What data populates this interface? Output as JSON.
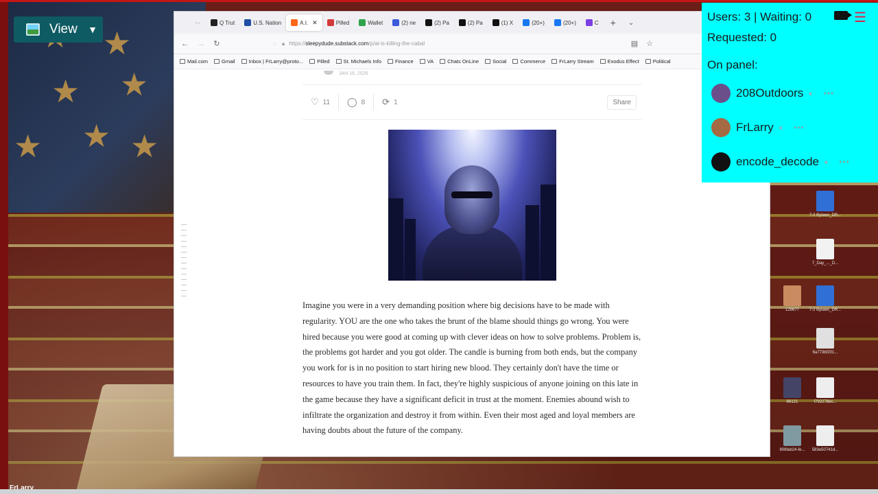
{
  "view_widget": {
    "label": "View"
  },
  "browser": {
    "tabs": [
      {
        "label": "Q Trut",
        "color": "#222222"
      },
      {
        "label": "U.S. Nation",
        "color": "#1f4ea3"
      },
      {
        "label": "A.I.",
        "color": "#ff6719",
        "active": true
      },
      {
        "label": "Pilled",
        "color": "#d33b3b"
      },
      {
        "label": "Wallet",
        "color": "#2fa34a"
      },
      {
        "label": "(2) ne",
        "color": "#3b5bdb"
      },
      {
        "label": "(2) Pa",
        "color": "#111111"
      },
      {
        "label": "(2) Pa",
        "color": "#111111"
      },
      {
        "label": "(1) X",
        "color": "#111111"
      },
      {
        "label": "(20+)",
        "color": "#1877f2"
      },
      {
        "label": "(20+)",
        "color": "#1877f2"
      },
      {
        "label": "C",
        "color": "#7b3fe4"
      }
    ],
    "url_prefix": "https://",
    "url_domain": "sleepydude.substack.com",
    "url_path": "/p/ai-is-killing-the-cabal",
    "bookmarks": [
      "Mail.com",
      "Gmail",
      "Inbox | FrLarry@proto...",
      "Pilled",
      "St. Michaels Info",
      "Finance",
      "VA",
      "Chats OnLine",
      "Social",
      "Commerce",
      "FrLarry Stream",
      "Exodus Effect",
      "Political"
    ]
  },
  "article": {
    "date": "JAN 16, 2026",
    "likes": "11",
    "comments": "8",
    "restacks": "1",
    "share_label": "Share",
    "body": "Imagine you were in a very demanding position where big decisions have to be made with regularity. YOU are the one who takes the brunt of the blame should things go wrong. You were hired because you were good at coming up with clever ideas on how to solve problems. Problem is, the problems got harder and you got older. The candle is burning from both ends, but the company you work for is in no position to start hiring new blood. They certainly don't have the time or resources to have you train them. In fact, they're highly suspicious of anyone joining on this late in the game because they have a significant deficit in trust at the moment. Enemies abound wish to infiltrate the organization and destroy it from within. Even their most aged and loyal members are having doubts about the future of the company."
  },
  "users_panel": {
    "users_line": "Users: 3 | Waiting: 0",
    "requested_line": "Requested: 0",
    "on_panel_label": "On panel:",
    "members": [
      {
        "name": "208Outdoors",
        "avatar_color": "#6b4f8a"
      },
      {
        "name": "FrLarry",
        "avatar_color": "#a46a44"
      },
      {
        "name": "encode_decode",
        "avatar_color": "#111111"
      }
    ]
  },
  "desktop": {
    "icons": [
      "7-2 Bylaws_DR...",
      "7_Day_..._D...",
      "129677",
      "7-2 Bylaws_DR...",
      "6a773bf201...",
      "86121",
      "f79227bbc...",
      "808fab24-fe...",
      "583e50741d..."
    ]
  },
  "bottom_label": "FrLarry"
}
